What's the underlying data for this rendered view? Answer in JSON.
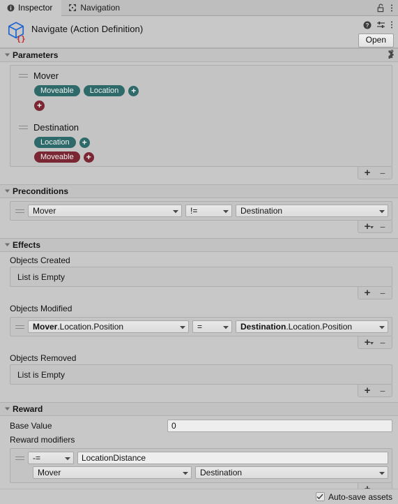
{
  "window": {
    "tabs": [
      {
        "label": "Inspector",
        "icon": "info-circle-icon",
        "active": true
      },
      {
        "label": "Navigation",
        "icon": "navigation-arrows-icon",
        "active": false
      }
    ],
    "lock_icon": "lock-open-icon",
    "tab_menu_icon": "kebab-menu-icon"
  },
  "asset": {
    "icon": "scriptable-object-cube-icon",
    "title": "Navigate (Action Definition)",
    "help_icon": "help-circle-icon",
    "preset_icon": "preset-sliders-icon",
    "menu_icon": "kebab-menu-icon",
    "open_label": "Open"
  },
  "parameters": {
    "header": "Parameters",
    "settings_icon": "gear-settings-icon",
    "items": [
      {
        "name": "Mover",
        "rows": [
          {
            "pills": [
              {
                "label": "Moveable",
                "color": "teal"
              },
              {
                "label": "Location",
                "color": "teal"
              }
            ],
            "add": "teal"
          },
          {
            "pills": [],
            "add": "maroon"
          }
        ]
      },
      {
        "name": "Destination",
        "rows": [
          {
            "pills": [
              {
                "label": "Location",
                "color": "teal"
              }
            ],
            "add": "teal"
          },
          {
            "pills": [
              {
                "label": "Moveable",
                "color": "maroon"
              }
            ],
            "add": "maroon"
          }
        ]
      }
    ],
    "footer": {
      "add": "+",
      "remove": "−",
      "has_dropdown": false
    }
  },
  "preconditions": {
    "header": "Preconditions",
    "rows": [
      {
        "left": "Mover",
        "operator": "!=",
        "right": "Destination"
      }
    ],
    "footer": {
      "add": "+",
      "remove": "−",
      "has_dropdown": true
    }
  },
  "effects": {
    "header": "Effects",
    "objects_created": {
      "label": "Objects Created",
      "empty_text": "List is Empty",
      "footer": {
        "add": "+",
        "remove": "−",
        "has_dropdown": false
      }
    },
    "objects_modified": {
      "label": "Objects Modified",
      "rows": [
        {
          "left_bold": "Mover",
          "left_rest": ".Location.Position",
          "operator": "=",
          "right_bold": "Destination",
          "right_rest": ".Location.Position"
        }
      ],
      "footer": {
        "add": "+",
        "remove": "−",
        "has_dropdown": true
      }
    },
    "objects_removed": {
      "label": "Objects Removed",
      "empty_text": "List is Empty",
      "footer": {
        "add": "+",
        "remove": "−",
        "has_dropdown": false
      }
    }
  },
  "reward": {
    "header": "Reward",
    "base_value_label": "Base Value",
    "base_value": "0",
    "modifiers_label": "Reward modifiers",
    "modifiers": [
      {
        "operator": "-=",
        "name": "LocationDistance",
        "arg1": "Mover",
        "arg2": "Destination"
      }
    ],
    "footer": {
      "add": "+",
      "remove": "−",
      "has_dropdown": true
    }
  },
  "footer": {
    "autosave_label": "Auto-save assets",
    "autosave_checked": true,
    "check_glyph": "✓"
  },
  "colors": {
    "panel_bg": "#c8c8c8",
    "section_bg": "#c2c2c2",
    "box_bg": "#c4c4c4",
    "field_bg": "#e4e4e4",
    "text_bg": "#eeeeee",
    "pill_teal": "#2e6a6a",
    "pill_maroon": "#7b2733",
    "cube_blue": "#1f64d0",
    "brace_red": "#c22a2a"
  }
}
